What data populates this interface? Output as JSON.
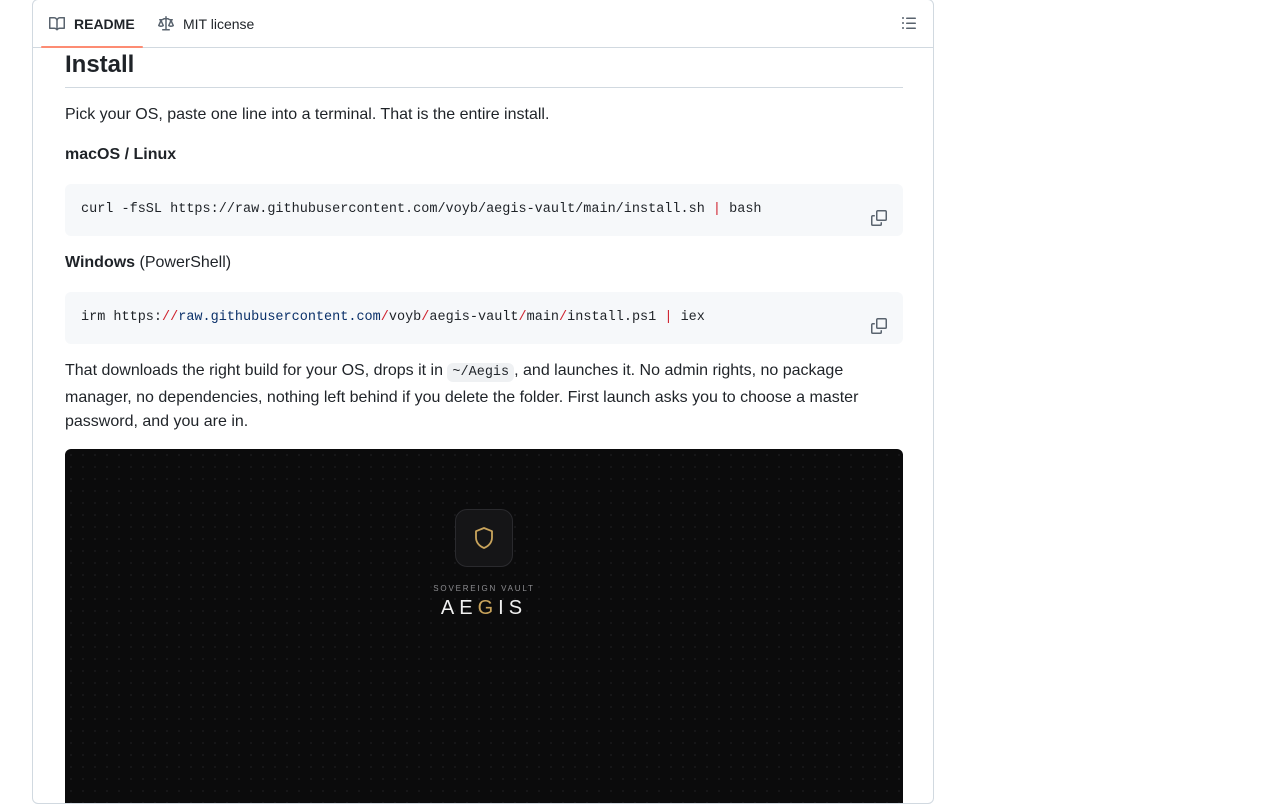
{
  "tabs": {
    "readme": "README",
    "license": "MIT license"
  },
  "install": {
    "heading": "Install",
    "intro": "Pick your OS, paste one line into a terminal. That is the entire install.",
    "mac_heading": "macOS / Linux",
    "mac_cmd_pre": "curl -fsSL https://raw.githubusercontent.com/voyb/aegis-vault/main/install.sh ",
    "mac_cmd_pipe": "|",
    "mac_cmd_post": " bash",
    "win_heading_bold": "Windows",
    "win_heading_rest": " (PowerShell)",
    "win_cmd": {
      "p1": "irm https:",
      "s1": "//",
      "host": "raw.githubusercontent.com",
      "s2": "/",
      "seg1": "voyb",
      "s3": "/",
      "seg2": "aegis-vault",
      "s4": "/",
      "seg3": "main",
      "s5": "/",
      "seg4": "install.ps1 ",
      "pipe": "|",
      "tail": " iex"
    },
    "desc_before": "That downloads the right build for your OS, drops it in ",
    "desc_code": "~/Aegis",
    "desc_after": ", and launches it. No admin rights, no package manager, no dependencies, nothing left behind if you delete the folder. First launch asks you to choose a master password, and you are in."
  },
  "preview": {
    "kicker": "SOVEREIGN VAULT",
    "brand_a": "AE",
    "brand_g": "G",
    "brand_b": "IS"
  },
  "icons": {
    "readme": "book-icon",
    "license": "law-scale-icon",
    "toc": "list-unordered-icon",
    "copy": "copy-icon",
    "logo": "shield-icon"
  },
  "colors": {
    "tab_underline": "#fd8c73",
    "code_bg": "#f6f8fa",
    "pipe": "#cf222e",
    "url": "#0a3069",
    "brand_accent": "#c9a45c",
    "preview_bg": "#0b0b0c"
  }
}
